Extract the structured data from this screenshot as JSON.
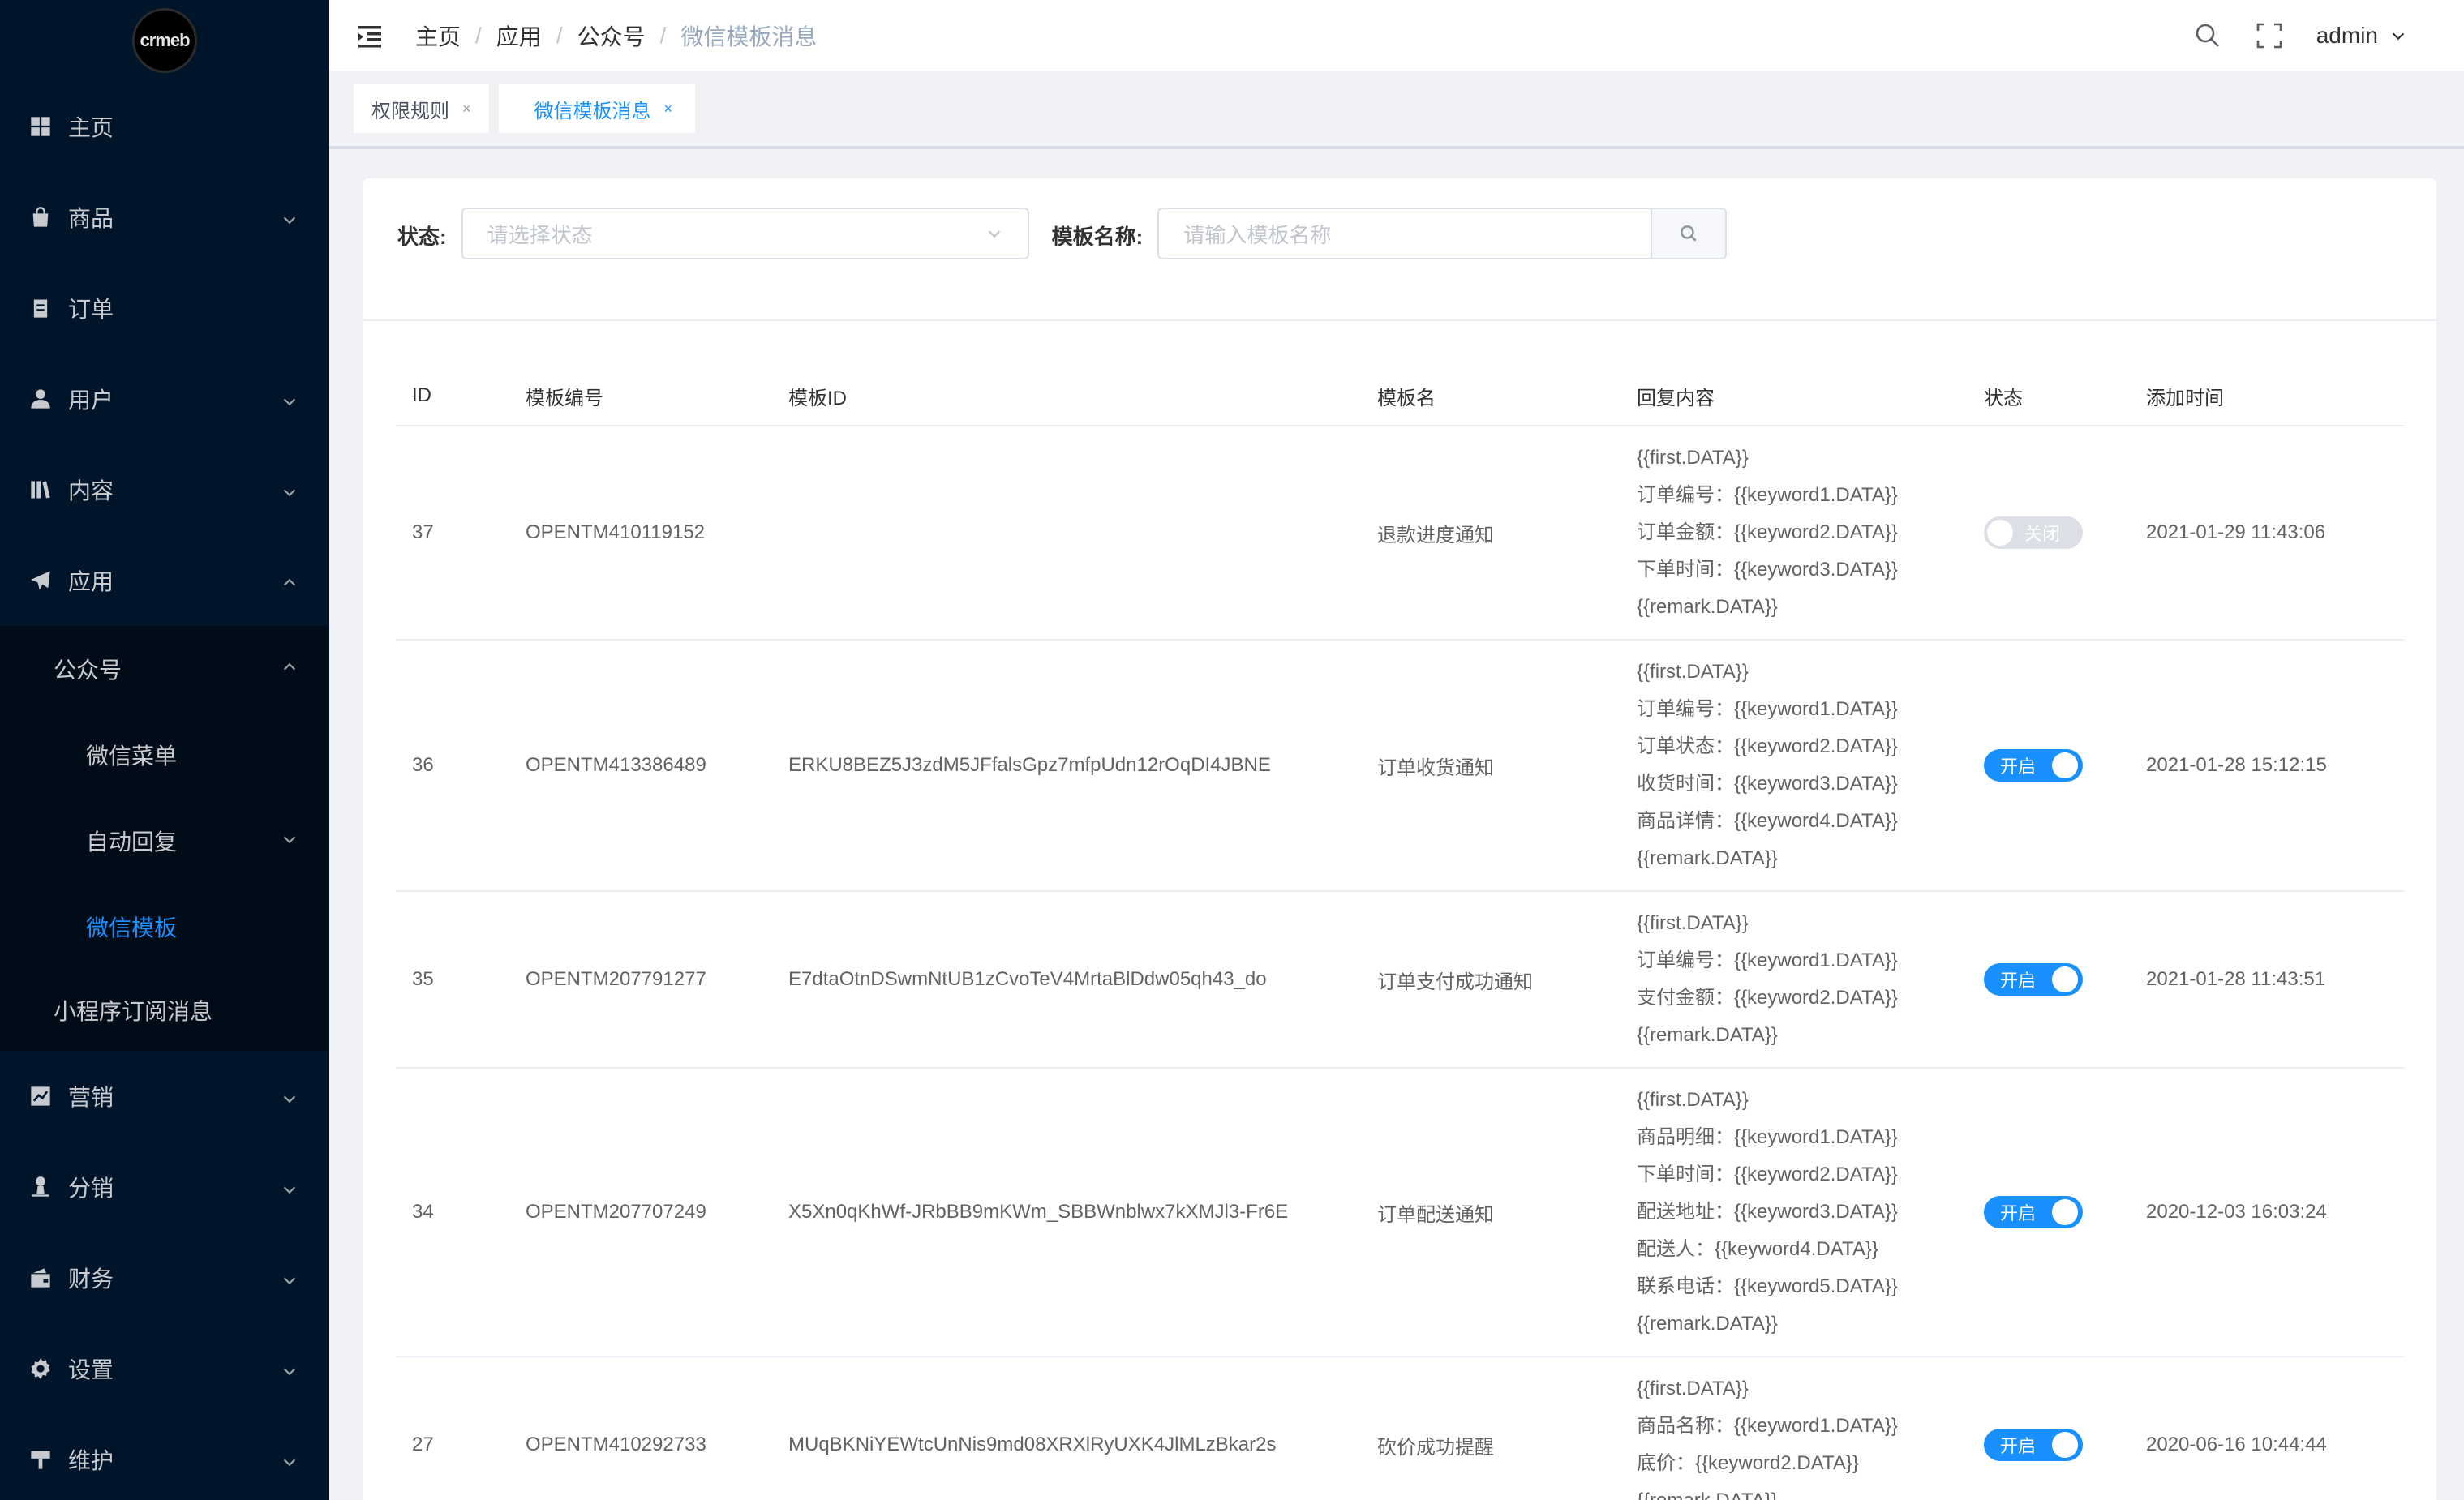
{
  "logo_text": "crmeb",
  "sidebar": {
    "items": [
      {
        "label": "主页",
        "icon": "dashboard-icon",
        "has_chevron": false
      },
      {
        "label": "商品",
        "icon": "shopping-bag-icon",
        "has_chevron": true
      },
      {
        "label": "订单",
        "icon": "clipboard-icon",
        "has_chevron": false
      },
      {
        "label": "用户",
        "icon": "user-icon",
        "has_chevron": true
      },
      {
        "label": "内容",
        "icon": "library-icon",
        "has_chevron": true
      },
      {
        "label": "应用",
        "icon": "send-icon",
        "has_chevron": true,
        "expanded": true
      }
    ],
    "app_sub": {
      "group_label": "公众号",
      "children": [
        "微信菜单",
        "自动回复",
        "微信模板"
      ],
      "active": "微信模板",
      "mini_program": "小程序订阅消息"
    },
    "items_after": [
      {
        "label": "营销",
        "icon": "chart-icon"
      },
      {
        "label": "分销",
        "icon": "distribution-icon"
      },
      {
        "label": "财务",
        "icon": "wallet-icon"
      },
      {
        "label": "设置",
        "icon": "gear-icon"
      },
      {
        "label": "维护",
        "icon": "tool-icon"
      }
    ]
  },
  "header": {
    "breadcrumb": [
      "主页",
      "应用",
      "公众号",
      "微信模板消息"
    ],
    "user": "admin"
  },
  "tags": [
    {
      "label": "权限规则",
      "close": "×"
    },
    {
      "label": "微信模板消息",
      "close": "×",
      "active": true
    }
  ],
  "filter": {
    "status_label": "状态:",
    "status_placeholder": "请选择状态",
    "name_label": "模板名称:",
    "name_placeholder": "请输入模板名称"
  },
  "table": {
    "columns": [
      "ID",
      "模板编号",
      "模板ID",
      "模板名",
      "回复内容",
      "状态",
      "添加时间"
    ],
    "rows": [
      {
        "id": "37",
        "no": "OPENTM410119152",
        "tid": "",
        "name": "退款进度通知",
        "reply": [
          "{{first.DATA}}",
          "订单编号：{{keyword1.DATA}}",
          "订单金额：{{keyword2.DATA}}",
          "下单时间：{{keyword3.DATA}}",
          "{{remark.DATA}}"
        ],
        "status": "关闭",
        "on": false,
        "time": "2021-01-29 11:43:06"
      },
      {
        "id": "36",
        "no": "OPENTM413386489",
        "tid": "ERKU8BEZ5J3zdM5JFfalsGpz7mfpUdn12rOqDI4JBNE",
        "name": "订单收货通知",
        "reply": [
          "{{first.DATA}}",
          "订单编号：{{keyword1.DATA}}",
          "订单状态：{{keyword2.DATA}}",
          "收货时间：{{keyword3.DATA}}",
          "商品详情：{{keyword4.DATA}}",
          "{{remark.DATA}}"
        ],
        "status": "开启",
        "on": true,
        "time": "2021-01-28 15:12:15"
      },
      {
        "id": "35",
        "no": "OPENTM207791277",
        "tid": "E7dtaOtnDSwmNtUB1zCvoTeV4MrtaBlDdw05qh43_do",
        "name": "订单支付成功通知",
        "reply": [
          "{{first.DATA}}",
          "订单编号：{{keyword1.DATA}}",
          "支付金额：{{keyword2.DATA}}",
          "{{remark.DATA}}"
        ],
        "status": "开启",
        "on": true,
        "time": "2021-01-28 11:43:51"
      },
      {
        "id": "34",
        "no": "OPENTM207707249",
        "tid": "X5Xn0qKhWf-JRbBB9mKWm_SBBWnblwx7kXMJl3-Fr6E",
        "name": "订单配送通知",
        "reply": [
          "{{first.DATA}}",
          "商品明细：{{keyword1.DATA}}",
          "下单时间：{{keyword2.DATA}}",
          "配送地址：{{keyword3.DATA}}",
          "配送人：{{keyword4.DATA}}",
          "联系电话：{{keyword5.DATA}}",
          "{{remark.DATA}}"
        ],
        "status": "开启",
        "on": true,
        "time": "2020-12-03 16:03:24"
      },
      {
        "id": "27",
        "no": "OPENTM410292733",
        "tid": "MUqBKNiYEWtcUnNis9md08XRXlRyUXK4JlMLzBkar2s",
        "name": "砍价成功提醒",
        "reply": [
          "{{first.DATA}}",
          "商品名称：{{keyword1.DATA}}",
          "底价：{{keyword2.DATA}}",
          "{{remark.DATA}}"
        ],
        "status": "开启",
        "on": true,
        "time": "2020-06-16 10:44:44"
      }
    ]
  },
  "colors": {
    "sidebar_bg": "#001529",
    "submenu_bg": "#000c17",
    "accent": "#1890ff",
    "switch_off": "#dcdfe6"
  }
}
